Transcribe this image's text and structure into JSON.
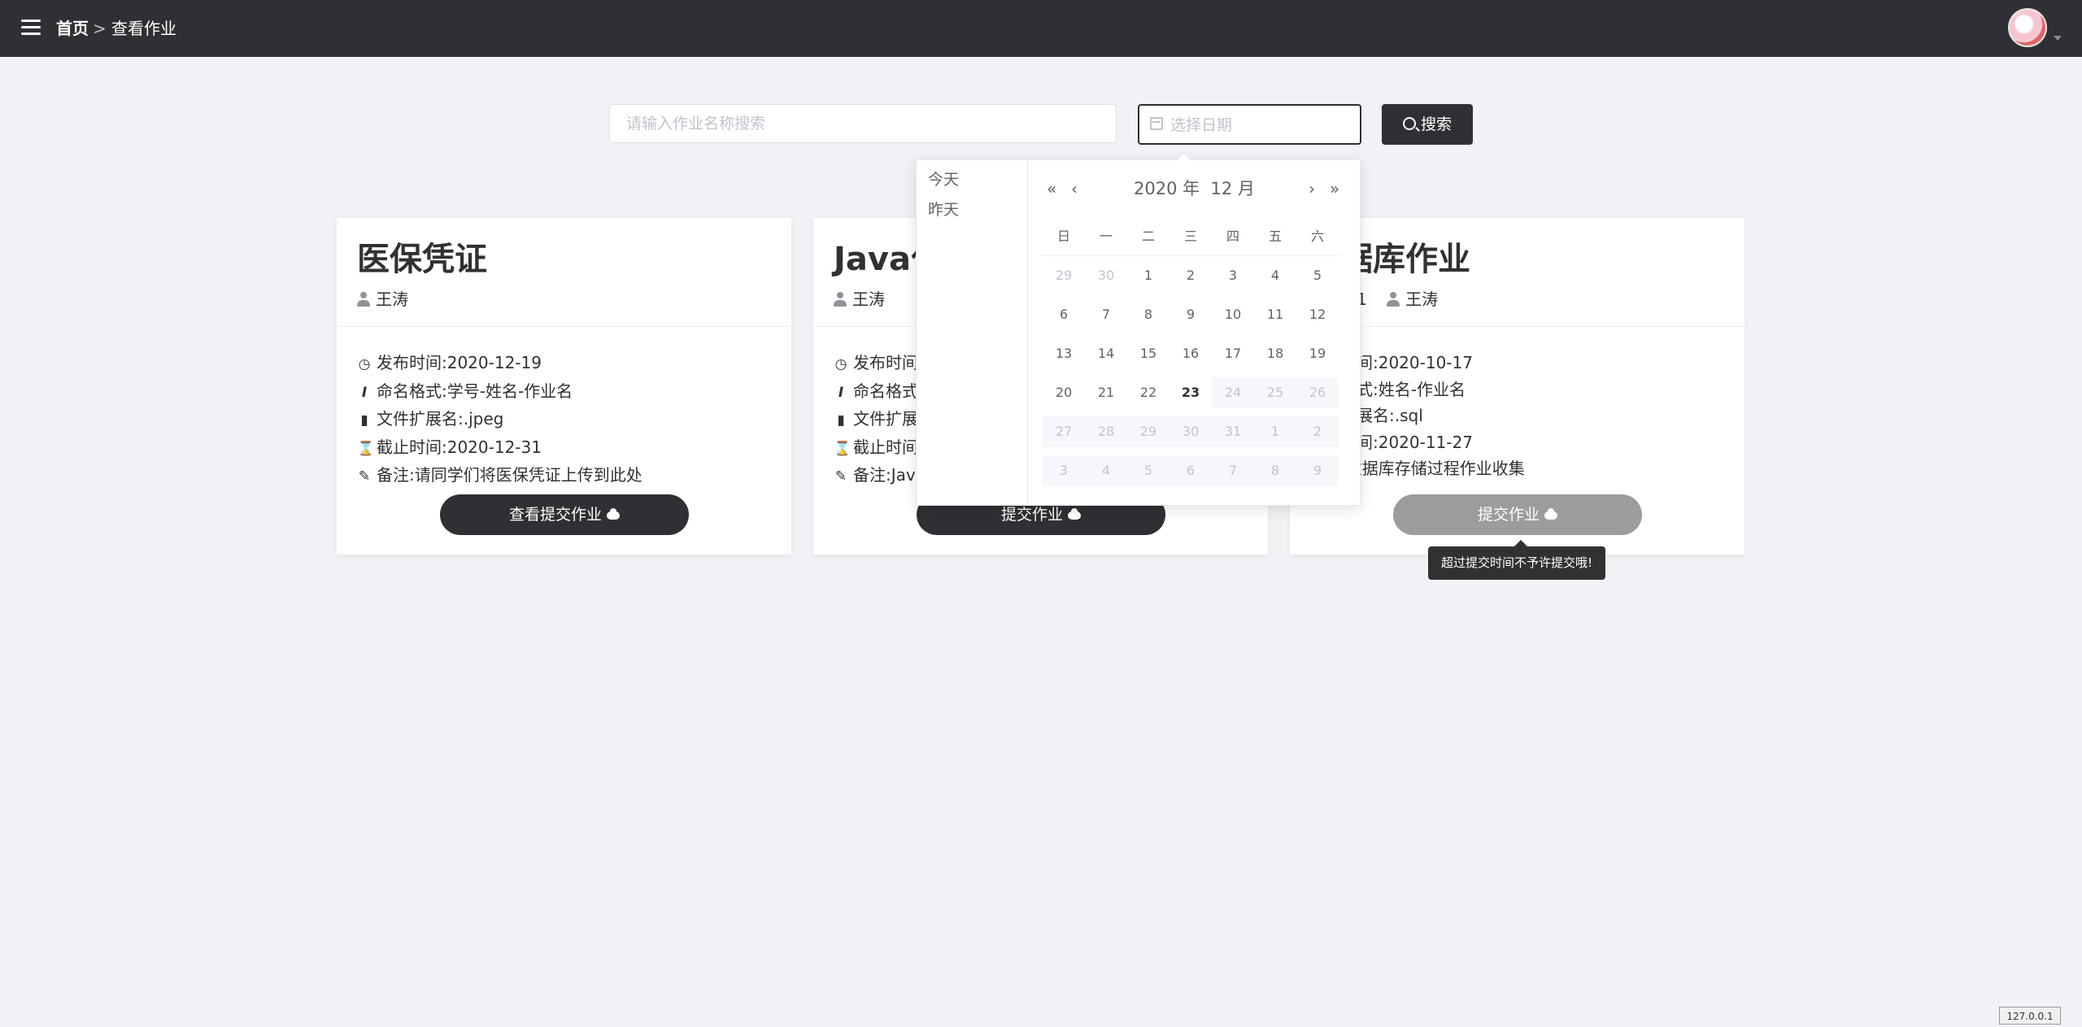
{
  "header": {
    "breadcrumb_home": "首页",
    "breadcrumb_separator": ">",
    "breadcrumb_current": "查看作业"
  },
  "search": {
    "name_placeholder": "请输入作业名称搜索",
    "name_value": "",
    "date_placeholder": "选择日期",
    "date_value": "",
    "button_label": "搜索"
  },
  "cards": [
    {
      "title": "医保凭证",
      "authors": [
        "王涛"
      ],
      "publish_time": "发布时间:2020-12-19",
      "naming_format": "命名格式:学号-姓名-作业名",
      "extension": "文件扩展名:.jpeg",
      "deadline": "截止时间:2020-12-31",
      "remark": "备注:请同学们将医保凭证上传到此处",
      "button_label": "查看提交作业",
      "button_disabled": false
    },
    {
      "title": "Java作",
      "authors": [
        "王涛"
      ],
      "publish_time": "发布时间",
      "naming_format": "命名格式",
      "extension": "文件扩展",
      "deadline": "截止时间",
      "remark": "备注:Jav",
      "button_label": "提交作业",
      "button_disabled": false
    },
    {
      "title": "据库作业",
      "authors": [
        "明1",
        "王涛"
      ],
      "publish_time": "时间:2020-10-17",
      "naming_format": "格式:姓名-作业名",
      "extension": "扩展名:.sql",
      "deadline": "时间:2020-11-27",
      "remark": ":数据库存储过程作业收集",
      "button_label": "提交作业",
      "button_disabled": true
    }
  ],
  "tooltip": "超过提交时间不予许提交哦!",
  "datepicker": {
    "shortcuts": [
      "今天",
      "昨天"
    ],
    "year_label": "2020 年",
    "month_label": "12 月",
    "weekdays": [
      "日",
      "一",
      "二",
      "三",
      "四",
      "五",
      "六"
    ],
    "today": 23,
    "weeks": [
      [
        {
          "d": "29",
          "t": "prev"
        },
        {
          "d": "30",
          "t": "prev"
        },
        {
          "d": "1",
          "t": "cur"
        },
        {
          "d": "2",
          "t": "cur"
        },
        {
          "d": "3",
          "t": "cur"
        },
        {
          "d": "4",
          "t": "cur"
        },
        {
          "d": "5",
          "t": "cur"
        }
      ],
      [
        {
          "d": "6",
          "t": "cur"
        },
        {
          "d": "7",
          "t": "cur"
        },
        {
          "d": "8",
          "t": "cur"
        },
        {
          "d": "9",
          "t": "cur"
        },
        {
          "d": "10",
          "t": "cur"
        },
        {
          "d": "11",
          "t": "cur"
        },
        {
          "d": "12",
          "t": "cur"
        }
      ],
      [
        {
          "d": "13",
          "t": "cur"
        },
        {
          "d": "14",
          "t": "cur"
        },
        {
          "d": "15",
          "t": "cur"
        },
        {
          "d": "16",
          "t": "cur"
        },
        {
          "d": "17",
          "t": "cur"
        },
        {
          "d": "18",
          "t": "cur"
        },
        {
          "d": "19",
          "t": "cur"
        }
      ],
      [
        {
          "d": "20",
          "t": "cur"
        },
        {
          "d": "21",
          "t": "cur"
        },
        {
          "d": "22",
          "t": "cur"
        },
        {
          "d": "23",
          "t": "today"
        },
        {
          "d": "24",
          "t": "future"
        },
        {
          "d": "25",
          "t": "future"
        },
        {
          "d": "26",
          "t": "future"
        }
      ],
      [
        {
          "d": "27",
          "t": "future"
        },
        {
          "d": "28",
          "t": "future"
        },
        {
          "d": "29",
          "t": "future"
        },
        {
          "d": "30",
          "t": "future"
        },
        {
          "d": "31",
          "t": "future"
        },
        {
          "d": "1",
          "t": "future"
        },
        {
          "d": "2",
          "t": "future"
        }
      ],
      [
        {
          "d": "3",
          "t": "future"
        },
        {
          "d": "4",
          "t": "future"
        },
        {
          "d": "5",
          "t": "future"
        },
        {
          "d": "6",
          "t": "future"
        },
        {
          "d": "7",
          "t": "future"
        },
        {
          "d": "8",
          "t": "future"
        },
        {
          "d": "9",
          "t": "future"
        }
      ]
    ]
  },
  "status_badge": "127.0.0.1",
  "colors": {
    "topbar": "#2f3033",
    "page_background": "#f0f2f5",
    "disabled_button": "#9c9c9c"
  }
}
